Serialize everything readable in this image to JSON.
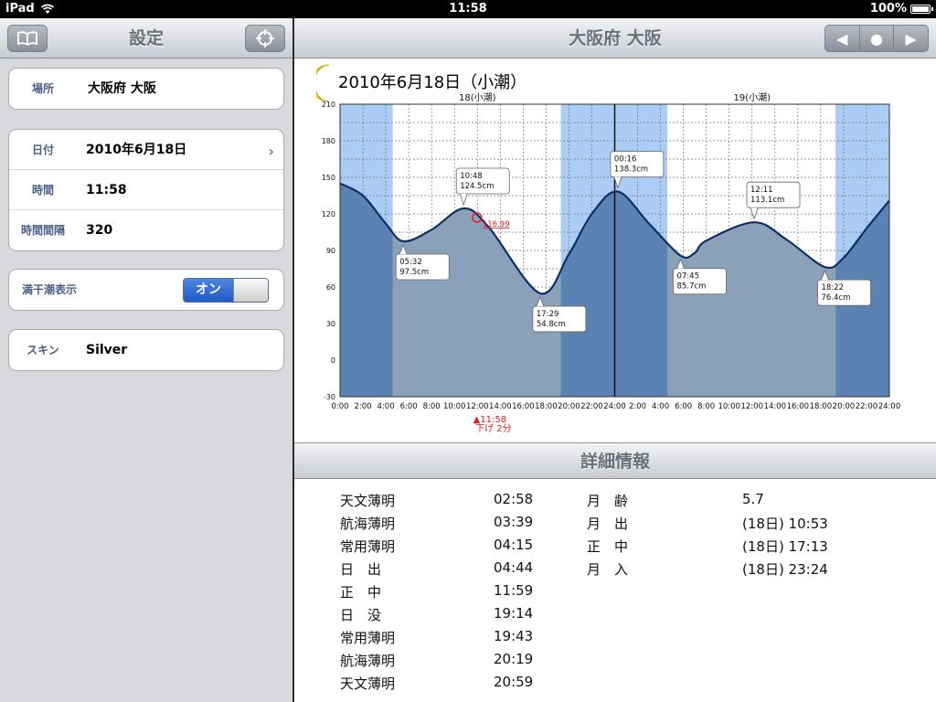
{
  "status": {
    "device": "iPad",
    "time": "11:58",
    "battery": "100%"
  },
  "left": {
    "title": "設定",
    "location": {
      "label": "場所",
      "value": "大阪府 大阪"
    },
    "date": {
      "label": "日付",
      "value": "2010年6月18日"
    },
    "time": {
      "label": "時間",
      "value": "11:58"
    },
    "interval": {
      "label": "時間間隔",
      "value": "320"
    },
    "tide_display": {
      "label": "満干潮表示",
      "toggle": "オン"
    },
    "skin": {
      "label": "スキン",
      "value": "Silver"
    }
  },
  "right": {
    "title": "大阪府 大阪"
  },
  "chart_data": {
    "type": "area",
    "title": "2010年6月18日（小潮）",
    "day_labels": [
      "18(小潮)",
      "19(小潮)"
    ],
    "ylim": [
      -30,
      210
    ],
    "yticks": [
      -30,
      0,
      30,
      60,
      90,
      120,
      150,
      180,
      210
    ],
    "xlim_hours": [
      0,
      48
    ],
    "xtick_labels": [
      "0:00",
      "2:00",
      "4:00",
      "6:00",
      "8:00",
      "10:00",
      "12:00",
      "14:00",
      "16:00",
      "18:00",
      "20:00",
      "22:00",
      "24:00",
      "2:00",
      "4:00",
      "6:00",
      "8:00",
      "10:00",
      "12:00",
      "14:00",
      "16:00",
      "18:00",
      "20:00",
      "22:00",
      "24:00"
    ],
    "night_bands_hours": [
      [
        0,
        4.6
      ],
      [
        19.3,
        28.6
      ],
      [
        43.3,
        48
      ]
    ],
    "series": [
      {
        "x_hours": [
          0,
          2,
          4,
          5.53,
          8,
          10.8,
          13,
          17.48,
          20,
          22,
          24.27,
          27,
          29.75,
          31,
          32,
          36.18,
          39,
          42.37,
          44,
          46,
          48
        ],
        "values": [
          145,
          135,
          112,
          97.5,
          107,
          124.5,
          109,
          54.8,
          87,
          120,
          138.3,
          112,
          85.7,
          88,
          98,
          113.1,
          99,
          76.4,
          84,
          108,
          131
        ]
      }
    ],
    "extrema": [
      {
        "hours": 5.53,
        "time": "05:32",
        "level": "97.5cm"
      },
      {
        "hours": 10.8,
        "time": "10:48",
        "level": "124.5cm"
      },
      {
        "hours": 17.48,
        "time": "17:29",
        "level": "54.8cm"
      },
      {
        "hours": 24.27,
        "time": "00:16",
        "level": "138.3cm"
      },
      {
        "hours": 29.75,
        "time": "07:45",
        "level": "85.7cm"
      },
      {
        "hours": 36.18,
        "time": "12:11",
        "level": "113.1cm"
      },
      {
        "hours": 42.37,
        "time": "18:22",
        "level": "76.4cm"
      }
    ],
    "current": {
      "hours": 11.97,
      "value": 116.99,
      "value_label": "116.99",
      "time_label": "▲11:58",
      "trend_label": "下げ 2分"
    },
    "colors": {
      "night": "#aaccf5",
      "fill_day": "#8aa1b9",
      "fill_night": "#5a83b4",
      "curve": "#0d2f66",
      "current": "#e02020"
    }
  },
  "details": {
    "title": "詳細情報",
    "sun": [
      {
        "label": "天文薄明",
        "value": "02:58"
      },
      {
        "label": "航海薄明",
        "value": "03:39"
      },
      {
        "label": "常用薄明",
        "value": "04:15"
      },
      {
        "label": "日　出",
        "value": "04:44"
      },
      {
        "label": "正　中",
        "value": "11:59"
      },
      {
        "label": "日　没",
        "value": "19:14"
      },
      {
        "label": "常用薄明",
        "value": "19:43"
      },
      {
        "label": "航海薄明",
        "value": "20:19"
      },
      {
        "label": "天文薄明",
        "value": "20:59"
      }
    ],
    "moon": [
      {
        "label": "月　齢",
        "value": "5.7"
      },
      {
        "label": "月　出",
        "value": "(18日) 10:53"
      },
      {
        "label": "正　中",
        "value": "(18日) 17:13"
      },
      {
        "label": "月　入",
        "value": "(18日) 23:24"
      }
    ]
  }
}
